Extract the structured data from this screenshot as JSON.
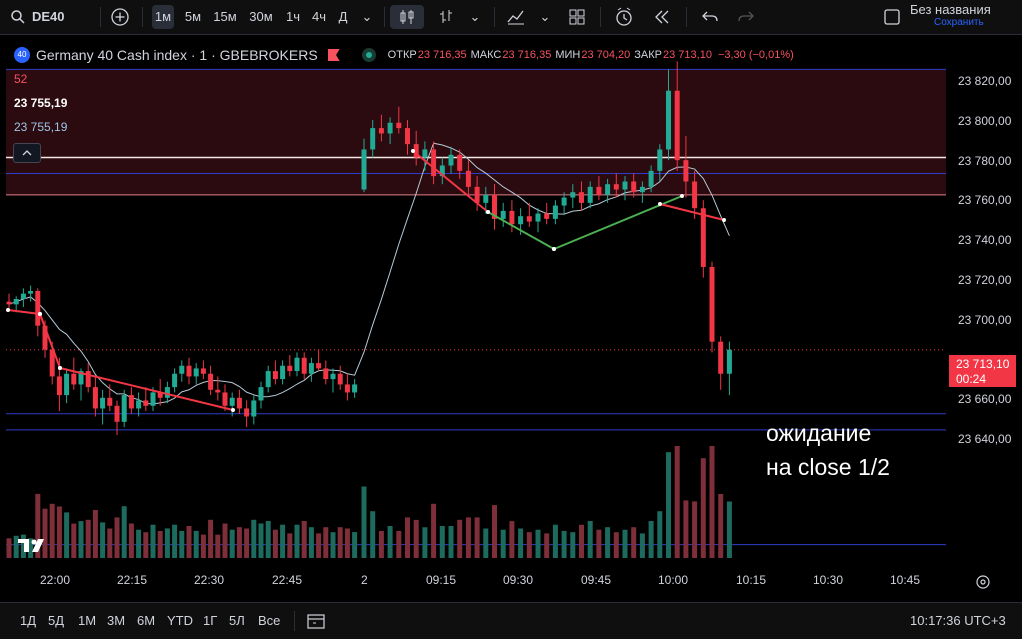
{
  "toolbar": {
    "symbol": "DE40",
    "intervals": [
      "1м",
      "5м",
      "15м",
      "30м",
      "1ч",
      "4ч",
      "Д"
    ],
    "active_interval": "1м",
    "layout_title": "Без названия",
    "layout_status": "Сохранить"
  },
  "legend": {
    "badge": "40",
    "title": "Germany 40 Cash index · 1 · GBEBROKERS",
    "open_label": "ОТКР",
    "open_value": "23 716,35",
    "high_label": "МАКС",
    "high_value": "23 716,35",
    "low_label": "МИН",
    "low_value": "23 704,20",
    "close_label": "ЗАКР",
    "close_value": "23 713,10",
    "change": "−3,30 (−0,01%)"
  },
  "indicators": {
    "line1": "52",
    "line2": "23 755,19",
    "line3": "23 755,19"
  },
  "price_axis": {
    "labels": [
      "23 820,00",
      "23 800,00",
      "23 780,00",
      "23 760,00",
      "23 740,00",
      "23 720,00",
      "23 700,00",
      "23 680,00",
      "23 660,00",
      "23 640,00"
    ],
    "current_price": "23 713,10",
    "countdown": "00:24"
  },
  "time_axis": {
    "labels": [
      "22:00",
      "22:15",
      "22:30",
      "22:45",
      "2",
      "09:15",
      "09:30",
      "09:45",
      "10:00",
      "10:15",
      "10:30",
      "10:45"
    ]
  },
  "annotation": {
    "line1": "ожидание",
    "line2": "на close 1/2"
  },
  "bottombar": {
    "ranges": [
      "1Д",
      "5Д",
      "1М",
      "3М",
      "6М",
      "YTD",
      "1Г",
      "5Л",
      "Все"
    ],
    "clock": "10:17:36 UTC+3"
  },
  "chart_data": {
    "type": "candlestick",
    "unit": "price",
    "y_range": [
      23632,
      23826
    ],
    "horizontal_lines": [
      23818,
      23785,
      23779,
      23771,
      23689,
      23683,
      23640
    ],
    "zone": [
      23771,
      23818
    ],
    "candles": [
      [
        23731,
        23734,
        23728,
        23730
      ],
      [
        23730,
        23733,
        23727,
        23732
      ],
      [
        23732,
        23736,
        23729,
        23734
      ],
      [
        23734,
        23737,
        23731,
        23735
      ],
      [
        23735,
        23736,
        23718,
        23722
      ],
      [
        23722,
        23724,
        23710,
        23713
      ],
      [
        23713,
        23716,
        23700,
        23703
      ],
      [
        23703,
        23710,
        23690,
        23696
      ],
      [
        23696,
        23706,
        23693,
        23704
      ],
      [
        23704,
        23710,
        23698,
        23700
      ],
      [
        23700,
        23706,
        23694,
        23705
      ],
      [
        23705,
        23708,
        23697,
        23699
      ],
      [
        23699,
        23703,
        23688,
        23691
      ],
      [
        23691,
        23698,
        23685,
        23695
      ],
      [
        23695,
        23700,
        23690,
        23692
      ],
      [
        23692,
        23694,
        23681,
        23686
      ],
      [
        23686,
        23698,
        23684,
        23696
      ],
      [
        23696,
        23699,
        23689,
        23691
      ],
      [
        23691,
        23697,
        23688,
        23694
      ],
      [
        23694,
        23699,
        23690,
        23692
      ],
      [
        23692,
        23699,
        23690,
        23697
      ],
      [
        23697,
        23702,
        23692,
        23695
      ],
      [
        23695,
        23701,
        23693,
        23699
      ],
      [
        23699,
        23706,
        23697,
        23704
      ],
      [
        23704,
        23709,
        23701,
        23707
      ],
      [
        23707,
        23710,
        23700,
        23703
      ],
      [
        23703,
        23708,
        23700,
        23706
      ],
      [
        23706,
        23709,
        23702,
        23704
      ],
      [
        23704,
        23707,
        23696,
        23698
      ],
      [
        23698,
        23703,
        23694,
        23697
      ],
      [
        23697,
        23700,
        23690,
        23692
      ],
      [
        23692,
        23697,
        23688,
        23695
      ],
      [
        23695,
        23698,
        23689,
        23691
      ],
      [
        23691,
        23694,
        23684,
        23688
      ],
      [
        23688,
        23696,
        23685,
        23694
      ],
      [
        23694,
        23701,
        23691,
        23699
      ],
      [
        23699,
        23707,
        23697,
        23705
      ],
      [
        23705,
        23709,
        23700,
        23702
      ],
      [
        23702,
        23709,
        23700,
        23707
      ],
      [
        23707,
        23711,
        23703,
        23705
      ],
      [
        23705,
        23712,
        23703,
        23710
      ],
      [
        23710,
        23712,
        23702,
        23704
      ],
      [
        23704,
        23710,
        23701,
        23708
      ],
      [
        23708,
        23713,
        23705,
        23706
      ],
      [
        23706,
        23709,
        23700,
        23702
      ],
      [
        23702,
        23706,
        23697,
        23704
      ],
      [
        23704,
        23707,
        23698,
        23700
      ],
      [
        23700,
        23704,
        23694,
        23697
      ],
      [
        23697,
        23702,
        23695,
        23700
      ],
      [
        23773,
        23792,
        23772,
        23788
      ],
      [
        23788,
        23799,
        23785,
        23796
      ],
      [
        23796,
        23801,
        23791,
        23794
      ],
      [
        23794,
        23800,
        23790,
        23798
      ],
      [
        23798,
        23804,
        23794,
        23796
      ],
      [
        23796,
        23799,
        23786,
        23790
      ],
      [
        23790,
        23795,
        23782,
        23785
      ],
      [
        23785,
        23791,
        23780,
        23788
      ],
      [
        23788,
        23791,
        23775,
        23778
      ],
      [
        23778,
        23785,
        23775,
        23782
      ],
      [
        23782,
        23789,
        23779,
        23786
      ],
      [
        23786,
        23788,
        23777,
        23780
      ],
      [
        23780,
        23784,
        23771,
        23774
      ],
      [
        23774,
        23778,
        23765,
        23768
      ],
      [
        23768,
        23774,
        23764,
        23771
      ],
      [
        23771,
        23775,
        23758,
        23762
      ],
      [
        23762,
        23768,
        23759,
        23765
      ],
      [
        23765,
        23769,
        23757,
        23760
      ],
      [
        23760,
        23766,
        23756,
        23763
      ],
      [
        23763,
        23768,
        23759,
        23761
      ],
      [
        23761,
        23766,
        23757,
        23764
      ],
      [
        23764,
        23768,
        23760,
        23762
      ],
      [
        23762,
        23769,
        23760,
        23767
      ],
      [
        23767,
        23772,
        23764,
        23770
      ],
      [
        23770,
        23775,
        23766,
        23772
      ],
      [
        23772,
        23776,
        23765,
        23768
      ],
      [
        23768,
        23776,
        23766,
        23774
      ],
      [
        23774,
        23778,
        23769,
        23771
      ],
      [
        23771,
        23777,
        23768,
        23775
      ],
      [
        23775,
        23779,
        23770,
        23773
      ],
      [
        23773,
        23778,
        23769,
        23776
      ],
      [
        23776,
        23779,
        23770,
        23772
      ],
      [
        23772,
        23776,
        23768,
        23774
      ],
      [
        23774,
        23782,
        23772,
        23780
      ],
      [
        23780,
        23790,
        23776,
        23788
      ],
      [
        23788,
        23818,
        23784,
        23810
      ],
      [
        23810,
        23821,
        23780,
        23784
      ],
      [
        23784,
        23793,
        23770,
        23776
      ],
      [
        23776,
        23780,
        23762,
        23766
      ],
      [
        23766,
        23769,
        23740,
        23744
      ],
      [
        23744,
        23746,
        23712,
        23716
      ],
      [
        23716,
        23718,
        23698,
        23704
      ],
      [
        23704,
        23716,
        23696,
        23713
      ]
    ],
    "gap_after_index": 48
  }
}
